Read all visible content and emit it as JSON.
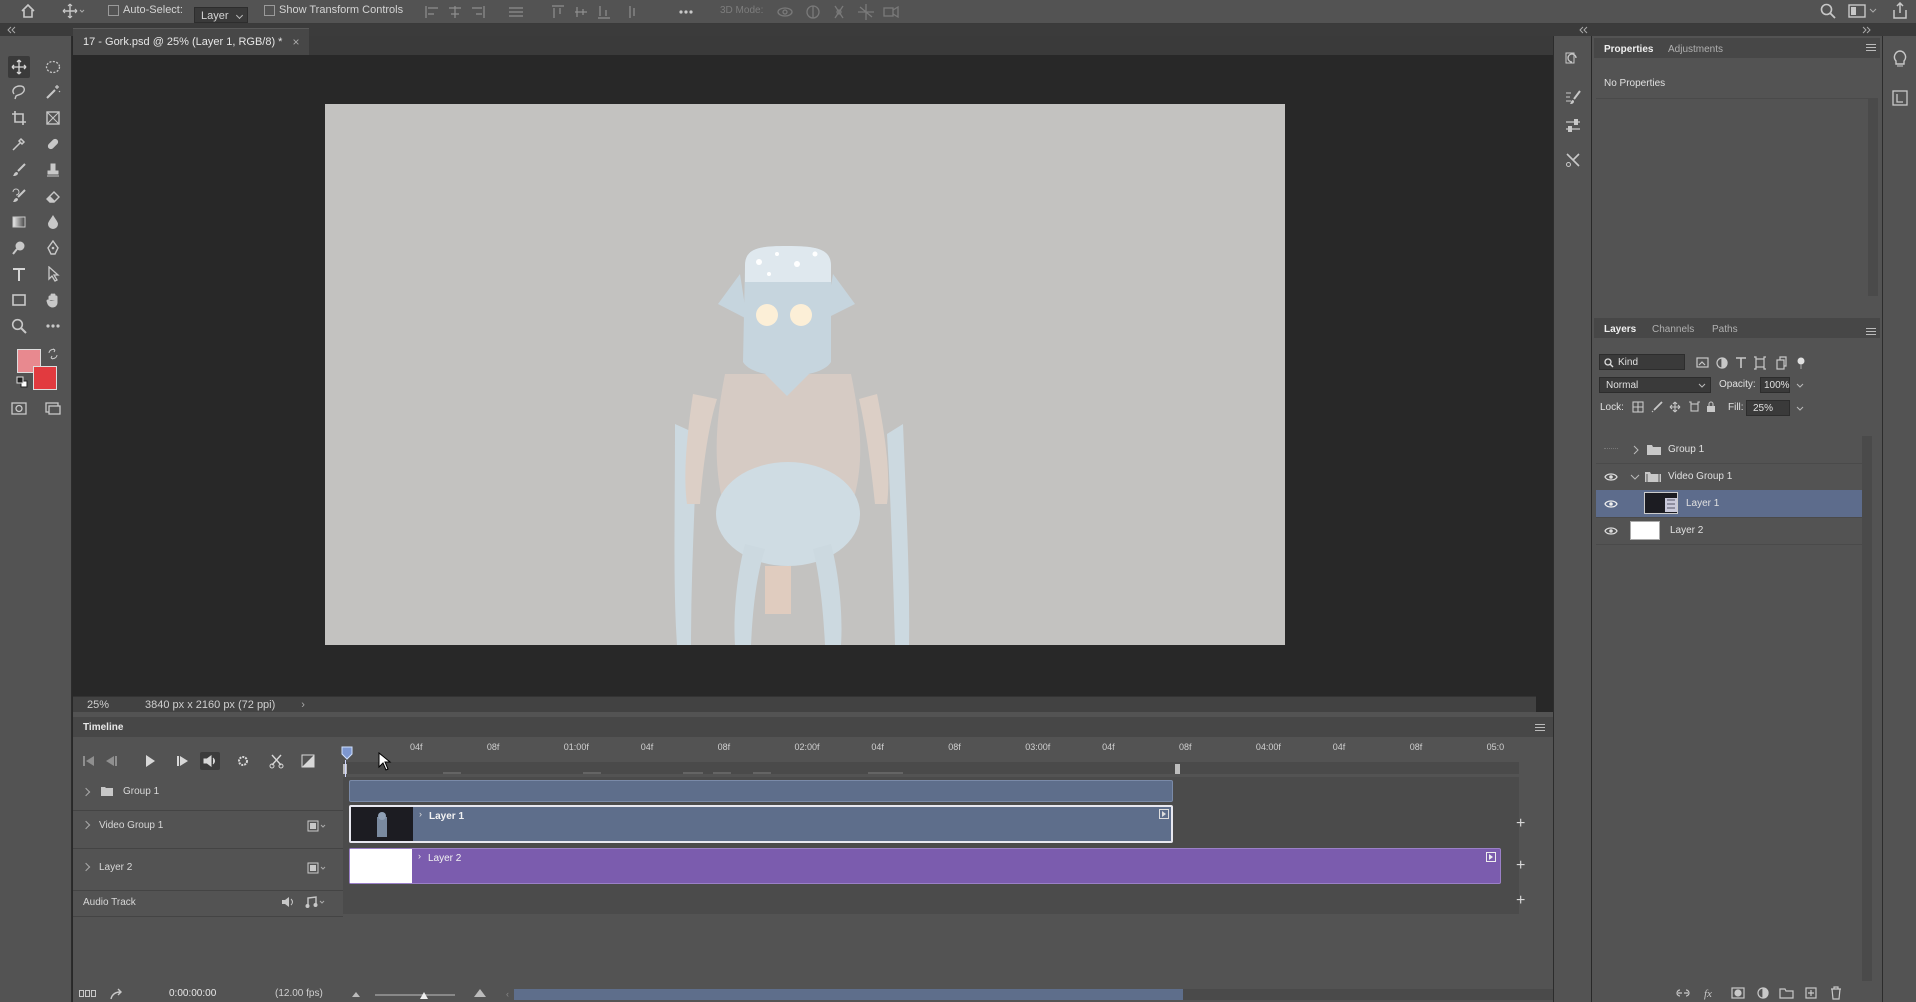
{
  "options_bar": {
    "auto_select_label": "Auto-Select:",
    "auto_select_value": "Layer",
    "show_transform_label": "Show Transform Controls",
    "mode_3d_label": "3D Mode:"
  },
  "document": {
    "tab_title": "17 - Gork.psd @ 25% (Layer 1, RGB/8) *",
    "zoom": "25%",
    "doc_info": "3840 px x 2160 px (72 ppi)"
  },
  "colors": {
    "foreground": "#e8898f",
    "background": "#e23a3f",
    "canvas_bg": "#c3c2c0",
    "selected_layer": "#5d6c8c",
    "clip_blue": "#5e6e8b",
    "clip_purple": "#7b5cae"
  },
  "timeline": {
    "title": "Timeline",
    "timecode": "0:00:00:00",
    "fps": "(12.00 fps)",
    "ruler": [
      "04f",
      "08f",
      "01:00f",
      "04f",
      "08f",
      "02:00f",
      "04f",
      "08f",
      "03:00f",
      "04f",
      "08f",
      "04:00f",
      "04f",
      "08f",
      "05:0"
    ],
    "tracks": [
      {
        "name": "Group 1"
      },
      {
        "name": "Video Group 1"
      },
      {
        "name": "Layer 2"
      },
      {
        "name": "Audio Track"
      }
    ],
    "clips": {
      "layer1": "Layer 1",
      "layer2": "Layer 2"
    }
  },
  "properties_panel": {
    "tab_properties": "Properties",
    "tab_adjustments": "Adjustments",
    "content": "No Properties"
  },
  "layers_panel": {
    "tab_layers": "Layers",
    "tab_channels": "Channels",
    "tab_paths": "Paths",
    "filter_kind": "Kind",
    "blend_mode": "Normal",
    "opacity_label": "Opacity:",
    "opacity_value": "100%",
    "lock_label": "Lock:",
    "fill_label": "Fill:",
    "fill_value": "25%",
    "layers": [
      {
        "name": "Group 1"
      },
      {
        "name": "Video Group 1"
      },
      {
        "name": "Layer 1"
      },
      {
        "name": "Layer 2"
      }
    ]
  }
}
